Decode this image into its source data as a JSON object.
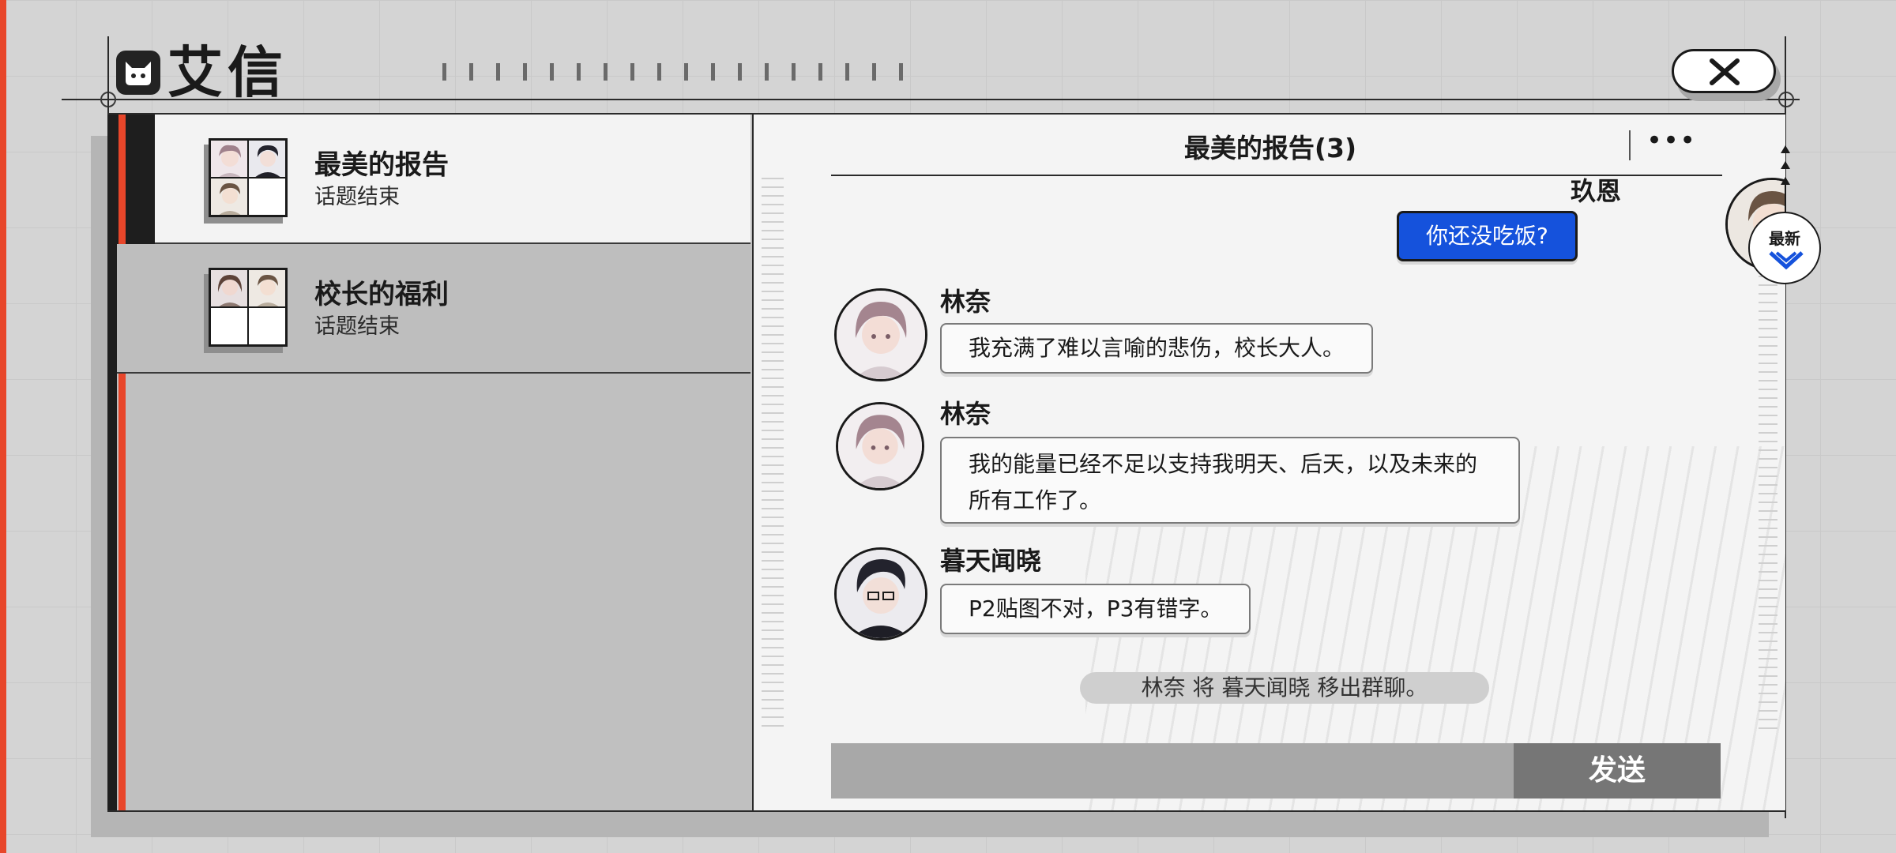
{
  "app": {
    "title": "艾信",
    "logo_icon": "cat-icon",
    "close_icon": "close-icon"
  },
  "conversations": [
    {
      "title": "最美的报告",
      "subtitle": "话题结束",
      "active": true
    },
    {
      "title": "校长的福利",
      "subtitle": "话题结束",
      "active": false
    }
  ],
  "chat": {
    "title": "最美的报告(3)",
    "more_label": "•••",
    "messages": [
      {
        "sender": "玖恩",
        "text": "你还没吃饭?",
        "self": true
      },
      {
        "sender": "林奈",
        "text": "我充满了难以言喻的悲伤，校长大人。",
        "self": false
      },
      {
        "sender": "林奈",
        "text": "我的能量已经不足以支持我明天、后天，以及未来的所有工作了。",
        "self": false
      },
      {
        "sender": "暮天闻晓",
        "text": "P2贴图不对，P3有错字。",
        "self": false
      }
    ],
    "system_message": "林奈 将 暮天闻晓 移出群聊。",
    "input_value": "",
    "send_label": "发送"
  },
  "latest_button": {
    "label": "最新",
    "icon": "double-chevron-down-icon"
  },
  "colors": {
    "accent_red": "#e8462a",
    "self_bubble": "#1552dc",
    "send_button": "#767676"
  }
}
